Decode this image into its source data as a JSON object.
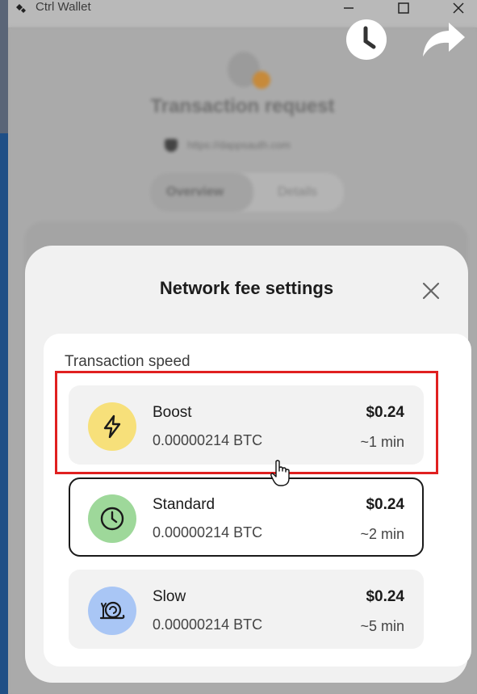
{
  "window": {
    "title": "Ctrl Wallet"
  },
  "background": {
    "title": "Transaction request",
    "site": "https://dappsauth.com",
    "tabs": [
      "Overview",
      "Details"
    ]
  },
  "modal": {
    "title": "Network fee settings",
    "section_label": "Transaction speed",
    "options": [
      {
        "name": "Boost",
        "btc": "0.00000214 BTC",
        "usd": "$0.24",
        "time": "~1 min",
        "icon": "lightning-icon",
        "icon_bg": "#f7e07a",
        "selected": false
      },
      {
        "name": "Standard",
        "btc": "0.00000214 BTC",
        "usd": "$0.24",
        "time": "~2 min",
        "icon": "clock-icon",
        "icon_bg": "#9ed89a",
        "selected": true
      },
      {
        "name": "Slow",
        "btc": "0.00000214 BTC",
        "usd": "$0.24",
        "time": "~5 min",
        "icon": "snail-icon",
        "icon_bg": "#a9c6f5",
        "selected": false
      }
    ]
  },
  "colors": {
    "highlight": "#e02020",
    "selected_border": "#1a1a1a"
  }
}
